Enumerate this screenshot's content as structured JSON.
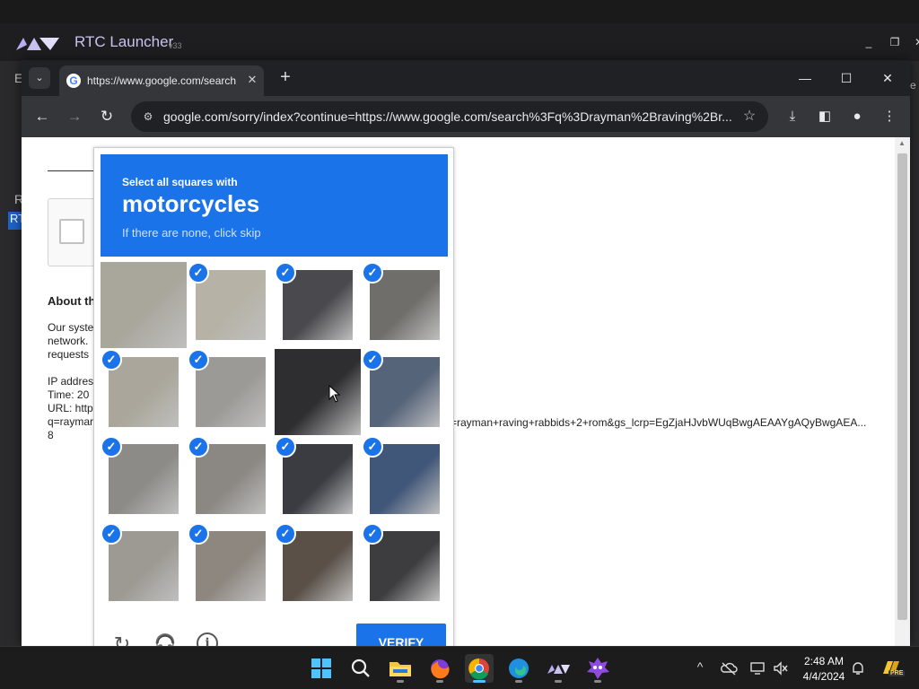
{
  "launcher": {
    "title": "RTC Launcher",
    "version": "v33",
    "minimize": "_",
    "maximize": "❐",
    "close": "✕",
    "side_letter_1": "E",
    "side_letter_2": "R",
    "side_letter_3": "RT",
    "right_edge_letter": "e"
  },
  "browser": {
    "tab_menu_icon": "chevron-down-icon",
    "tab_menu_glyph": "⌄",
    "tab": {
      "favicon": "G",
      "title": "https://www.google.com/search",
      "close": "✕"
    },
    "new_tab": "+",
    "window_controls": {
      "minimize": "—",
      "maximize": "☐",
      "close": "✕"
    },
    "nav": {
      "back": "←",
      "forward": "→",
      "reload": "↻"
    },
    "site_info": "⚙",
    "url": "google.com/sorry/index?continue=https://www.google.com/search%3Fq%3Drayman%2Braving%2Br...",
    "bookmark": "☆",
    "download": "⤓",
    "side_panel": "◧",
    "profile": "●",
    "menu": "⋮"
  },
  "page": {
    "about_heading": "About th",
    "body_lines": [
      "Our syste",
      "network.",
      "requests"
    ],
    "details_lines": [
      "IP addres",
      "Time: 20",
      "URL: http",
      "q=raymar",
      "8"
    ],
    "url_tail": "=rayman+raving+rabbids+2+rom&gs_lcrp=EgZjaHJvbWUqBwgAEAAYgAQyBwgAEA..."
  },
  "captcha": {
    "instruction_top": "Select all squares with",
    "target": "motorcycles",
    "instruction_sub": "If there are none, click skip",
    "tiles": [
      {
        "selected": false,
        "focused": false,
        "color": "#a9a69c"
      },
      {
        "selected": true,
        "focused": false,
        "color": "#b6b2a6"
      },
      {
        "selected": true,
        "focused": false,
        "color": "#4a4a4e"
      },
      {
        "selected": true,
        "focused": false,
        "color": "#6f6e6a"
      },
      {
        "selected": true,
        "focused": false,
        "color": "#aaa69b"
      },
      {
        "selected": true,
        "focused": false,
        "color": "#9c9a96"
      },
      {
        "selected": false,
        "focused": true,
        "color": "#2e2e31"
      },
      {
        "selected": true,
        "focused": false,
        "color": "#56647a"
      },
      {
        "selected": true,
        "focused": false,
        "color": "#8c8b87"
      },
      {
        "selected": true,
        "focused": false,
        "color": "#8b8883"
      },
      {
        "selected": true,
        "focused": false,
        "color": "#3a3c42"
      },
      {
        "selected": true,
        "focused": false,
        "color": "#415779"
      },
      {
        "selected": true,
        "focused": false,
        "color": "#9d9a94"
      },
      {
        "selected": true,
        "focused": false,
        "color": "#8e8780"
      },
      {
        "selected": true,
        "focused": false,
        "color": "#5a5048"
      },
      {
        "selected": true,
        "focused": false,
        "color": "#3d3d40"
      }
    ],
    "check_glyph": "✓",
    "reload_icon": "↻",
    "audio_icon": "🎧",
    "info_icon": "i",
    "verify_label": "VERIFY"
  },
  "taskbar": {
    "tray_chevron": "^",
    "time": "2:48 AM",
    "date": "4/4/2024",
    "badge": "PRE"
  },
  "colors": {
    "accent": "#1a73e8",
    "chrome_dark": "#202124",
    "chrome_toolbar": "#35363a"
  }
}
